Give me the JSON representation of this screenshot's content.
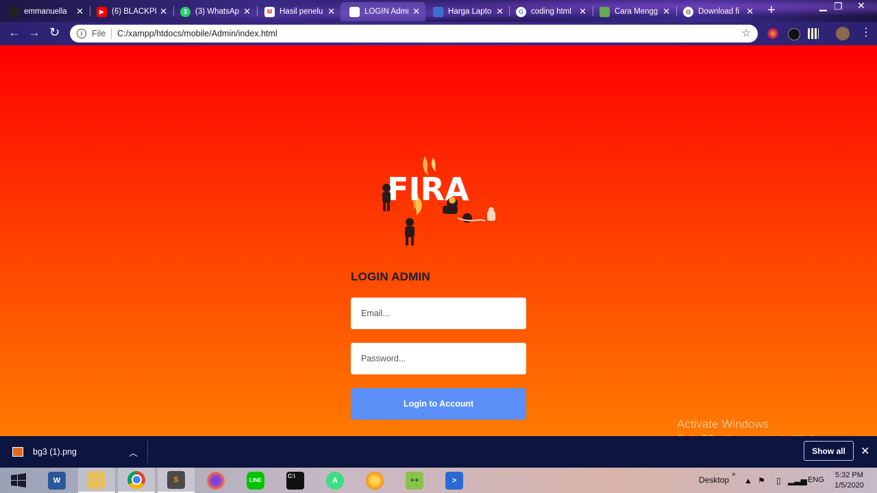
{
  "browser": {
    "tabs": [
      {
        "title": "emmanuella",
        "icon": "emmanuella-favicon",
        "color": "#222222"
      },
      {
        "title": "(6) BLACKPI",
        "icon": "youtube-icon",
        "color": "#ff0000"
      },
      {
        "title": "(3) WhatsAp",
        "icon": "whatsapp-icon",
        "color": "#25d366"
      },
      {
        "title": "Hasil penelu",
        "icon": "gmail-icon",
        "color": "#ffffff"
      },
      {
        "title": "LOGIN Admi",
        "icon": "blank-page-icon",
        "color": "#ffffff",
        "active": true
      },
      {
        "title": "Harga Lapto",
        "icon": "laptop-site-icon",
        "color": "#3b6fd4"
      },
      {
        "title": "coding html",
        "icon": "google-icon",
        "color": "#ffffff"
      },
      {
        "title": "Cara Mengg",
        "icon": "site-icon",
        "color": "#6aa84f"
      },
      {
        "title": "Download fi",
        "icon": "globe-icon",
        "color": "#ffffff"
      }
    ],
    "address": {
      "scheme_label": "File",
      "url": "C:/xampp/htdocs/mobile/Admin/index.html"
    }
  },
  "page": {
    "logo_text": "FIRA",
    "heading": "LOGIN ADMIN",
    "email_placeholder": "Email...",
    "password_placeholder": "Password...",
    "login_button": "Login to Account",
    "watermark_title": "Activate Windows",
    "watermark_sub": "Go to PC settings to activate Windows.",
    "colors": {
      "background_top": "#ff0000",
      "background_bottom": "#ff7a00",
      "button": "#5b8ff7"
    }
  },
  "download_bar": {
    "file_name": "bg3 (1).png",
    "show_all": "Show all"
  },
  "taskbar": {
    "apps": [
      "word-icon",
      "file-explorer-icon",
      "chrome-icon",
      "sublime-text-icon",
      "firefox-icon",
      "line-icon",
      "command-prompt-icon",
      "android-studio-icon",
      "media-player-icon",
      "notepad-plus-plus-icon",
      "powershell-icon"
    ],
    "desktop_label": "Desktop",
    "language": "ENG",
    "time": "5:32 PM",
    "date": "1/5/2020"
  }
}
